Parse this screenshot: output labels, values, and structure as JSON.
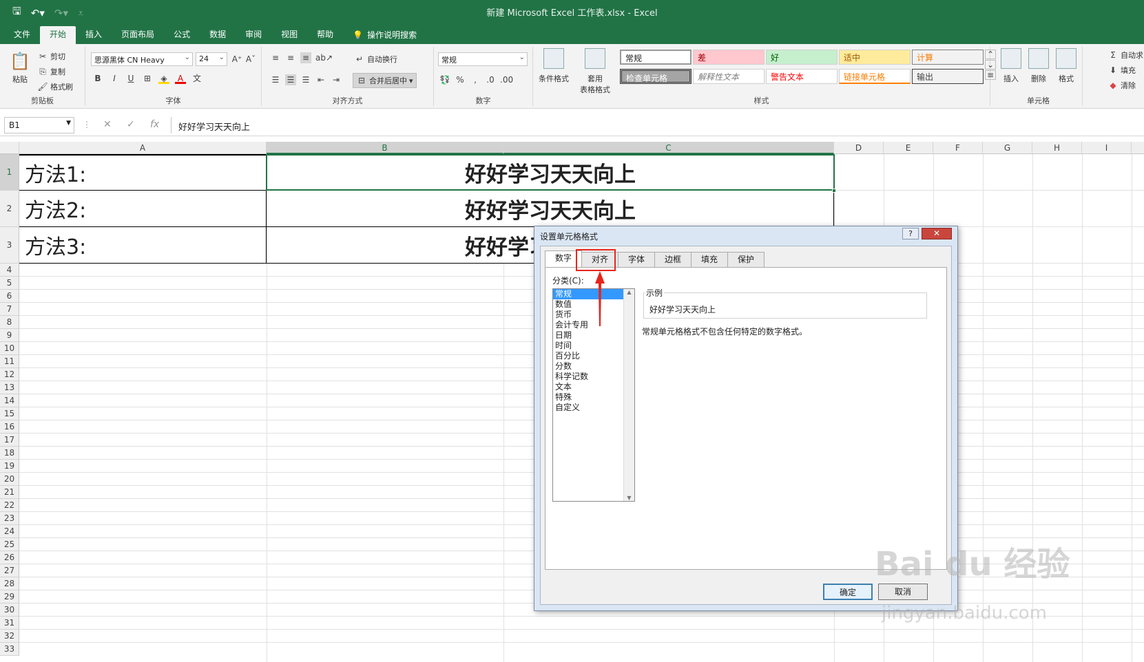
{
  "window": {
    "title": "新建 Microsoft Excel 工作表.xlsx  -  Excel"
  },
  "ribbon_tabs": [
    "文件",
    "开始",
    "插入",
    "页面布局",
    "公式",
    "数据",
    "审阅",
    "视图",
    "帮助",
    "操作说明搜索"
  ],
  "clipboard": {
    "paste": "粘贴",
    "cut": "剪切",
    "copy": "复制",
    "format_painter": "格式刷",
    "label": "剪贴板"
  },
  "font": {
    "name": "思源黑体 CN Heavy",
    "size": "24",
    "label": "字体"
  },
  "alignment": {
    "wrap": "自动换行",
    "merge": "合并后居中",
    "label": "对齐方式"
  },
  "number": {
    "format": "常规",
    "label": "数字"
  },
  "styles": {
    "cond_format": "条件格式",
    "table_format": "套用\n表格格式",
    "cells": [
      "常规",
      "差",
      "好",
      "适中",
      "计算",
      "检查单元格",
      "解释性文本",
      "警告文本",
      "链接单元格",
      "输出"
    ],
    "label": "样式"
  },
  "cells_group": {
    "insert": "插入",
    "delete": "删除",
    "format": "格式",
    "label": "单元格"
  },
  "editing": {
    "autosum": "自动求",
    "fill": "填充",
    "clear": "清除"
  },
  "formula_bar": {
    "name_box": "B1",
    "value": "好好学习天天向上",
    "fx": "fx"
  },
  "columns": [
    "A",
    "B",
    "C",
    "D",
    "E",
    "F",
    "G",
    "H",
    "I"
  ],
  "rows": [
    "1",
    "2",
    "3",
    "4",
    "5",
    "6",
    "7",
    "8",
    "9",
    "10",
    "11",
    "12",
    "13",
    "14",
    "15",
    "16",
    "17",
    "18",
    "19",
    "20",
    "21",
    "22",
    "23",
    "24",
    "25",
    "26",
    "27",
    "28",
    "29",
    "30",
    "31",
    "32",
    "33"
  ],
  "cells": {
    "a1": "方法1:",
    "a2": "方法2:",
    "a3": "方法3:",
    "b1": "好好学习天天向上",
    "b2": "好好学习天天向上",
    "b3": "好好学习天天向上"
  },
  "dialog": {
    "title": "设置单元格格式",
    "help": "?",
    "close": "✕",
    "tabs": [
      "数字",
      "对齐",
      "字体",
      "边框",
      "填充",
      "保护"
    ],
    "category_label": "分类(C):",
    "categories": [
      "常规",
      "数值",
      "货币",
      "会计专用",
      "日期",
      "时间",
      "百分比",
      "分数",
      "科学记数",
      "文本",
      "特殊",
      "自定义"
    ],
    "sample_label": "示例",
    "sample_value": "好好学习天天向上",
    "description": "常规单元格格式不包含任何特定的数字格式。",
    "ok": "确定",
    "cancel": "取消"
  },
  "watermark": {
    "brand": "Bai du 经验",
    "url": "jingyan.baidu.com"
  },
  "colors": {
    "excel_green": "#217346",
    "highlight_red": "#e8241c",
    "selection_blue": "#3399ff"
  }
}
